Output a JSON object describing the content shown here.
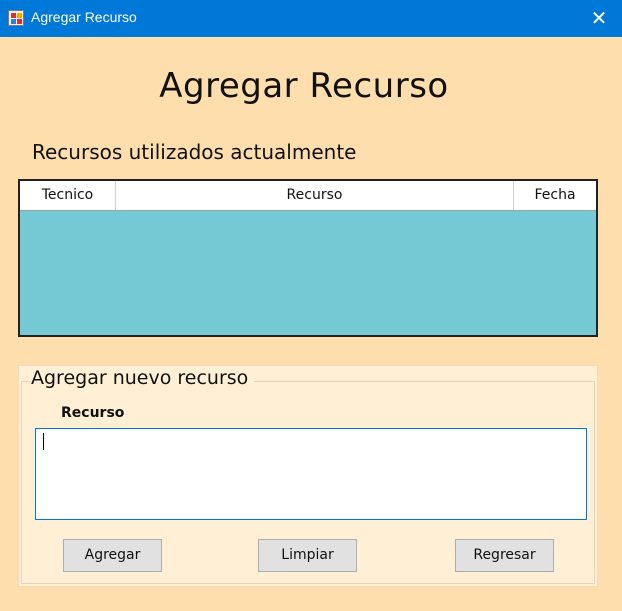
{
  "window": {
    "title": "Agregar Recurso",
    "close_glyph": "✕"
  },
  "heading": "Agregar Recurso",
  "current_resources": {
    "label": "Recursos utilizados actualmente",
    "columns": [
      "Tecnico",
      "Recurso",
      "Fecha"
    ],
    "rows": [],
    "background": "#75C9D4"
  },
  "new_resource": {
    "group_label": "Agregar nuevo recurso",
    "field_label": "Recurso",
    "field_value": "",
    "buttons": {
      "add": "Agregar",
      "clear": "Limpiar",
      "back": "Regresar"
    }
  },
  "colors": {
    "titlebar": "#0078D7",
    "form_background": "#FFDEAD",
    "group_background": "#FFEFD5",
    "button": "#E1E1E1"
  }
}
